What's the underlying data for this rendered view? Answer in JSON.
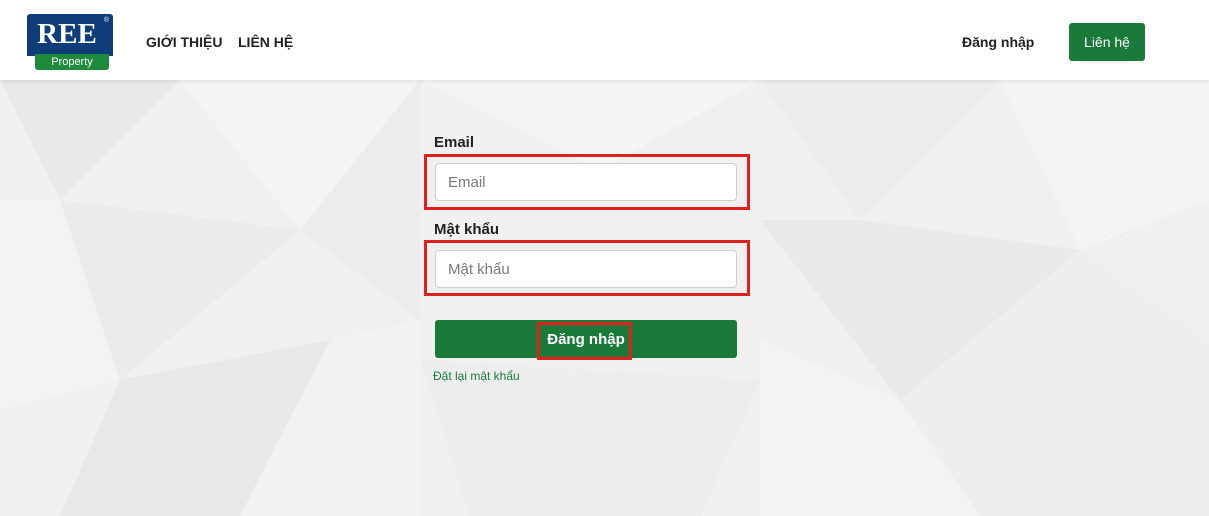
{
  "brand": {
    "logo_mark": "REE",
    "logo_registered": "®",
    "logo_subtitle": "Property",
    "logo_top_color": "#0f3d7a",
    "logo_bottom_color": "#1d8a3c"
  },
  "nav": {
    "about_label": "GIỚI THIỆU",
    "contact_label": "LIÊN HỆ"
  },
  "header_actions": {
    "login_label": "Đăng nhập",
    "contact_button_label": "Liên hệ"
  },
  "form": {
    "email_label": "Email",
    "email_placeholder": "Email",
    "email_value": "",
    "password_label": "Mật khẩu",
    "password_placeholder": "Mật khẩu",
    "password_value": "",
    "submit_label": "Đăng nhập",
    "reset_link_label": "Đặt lại mật khẩu"
  },
  "colors": {
    "accent_green": "#1a7a3a",
    "highlight_red": "#e0201f",
    "background_gray": "#f0f0f0"
  }
}
